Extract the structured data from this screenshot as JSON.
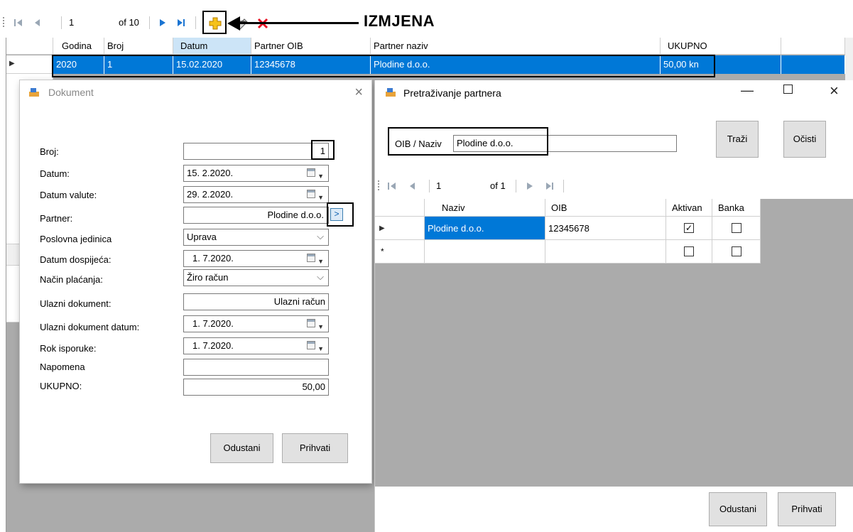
{
  "main_toolbar": {
    "position": "1",
    "of_label": "of 10",
    "annotation": "IZMJENA"
  },
  "main_grid": {
    "columns": [
      "Godina",
      "Broj",
      "Datum",
      "Partner OIB",
      "Partner naziv",
      "UKUPNO"
    ],
    "row": {
      "godina": "2020",
      "broj": "1",
      "datum": "15.02.2020",
      "partner_oib": "12345678",
      "partner_naziv": "Plodine d.o.o.",
      "ukupno": "50,00 kn"
    }
  },
  "dokument_dialog": {
    "title": "Dokument",
    "labels": {
      "broj": "Broj:",
      "datum": "Datum:",
      "datum_valute": "Datum valute:",
      "partner": "Partner:",
      "poslovna_jedinica": "Poslovna jedinica",
      "datum_dospijeca": "Datum dospijeća:",
      "nacin_placanja": "Način plaćanja:",
      "ulazni_dokument": "Ulazni dokument:",
      "ulazni_dokument_datum": "Ulazni dokument datum:",
      "rok_isporuke": "Rok isporuke:",
      "napomena": "Napomena",
      "ukupno": "UKUPNO:"
    },
    "values": {
      "broj": "1",
      "datum": "15. 2.2020.",
      "datum_valute": "29. 2.2020.",
      "partner": "Plodine d.o.o.",
      "poslovna_jedinica": "Uprava",
      "datum_dospijeca": "1. 7.2020.",
      "nacin_placanja": "Žiro račun",
      "ulazni_dokument": "Ulazni račun",
      "ulazni_dokument_datum": "1. 7.2020.",
      "rok_isporuke": "1. 7.2020.",
      "napomena": "",
      "ukupno": "50,00"
    },
    "partner_button_label": ">",
    "buttons": {
      "cancel": "Odustani",
      "accept": "Prihvati"
    }
  },
  "partner_dialog": {
    "title": "Pretraživanje partnera",
    "search_label": "OIB / Naziv",
    "search_value": "Plodine d.o.o.",
    "buttons": {
      "search": "Traži",
      "clear": "Očisti",
      "cancel": "Odustani",
      "accept": "Prihvati"
    },
    "nav": {
      "position": "1",
      "of_label": "of 1"
    },
    "columns": [
      "Naziv",
      "OIB",
      "Aktivan",
      "Banka"
    ],
    "rows": [
      {
        "naziv": "Plodine d.o.o.",
        "oib": "12345678",
        "aktivan": true,
        "banka": false
      }
    ],
    "new_row_marker": "*"
  },
  "colors": {
    "selection": "#0078d7",
    "grid_bg": "#ababab",
    "delete": "#e81123",
    "add": "#f0b400"
  },
  "icons": [
    "move-first-icon",
    "move-prev-icon",
    "move-next-icon",
    "move-last-icon",
    "add-icon",
    "edit-icon",
    "delete-icon",
    "calendar-icon",
    "chevron-down-icon",
    "close-icon",
    "minimize-icon",
    "maximize-icon",
    "app-icon"
  ]
}
